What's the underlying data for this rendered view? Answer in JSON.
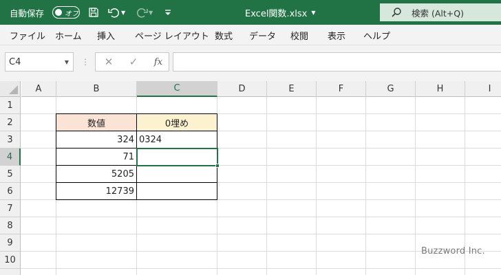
{
  "titlebar": {
    "autosave_label": "自動保存",
    "autosave_state": "オフ",
    "file_title": "Excel関数.xlsx",
    "search_text": "検索 (Alt+Q)",
    "bg_color": "#217346"
  },
  "menu": {
    "items": [
      "ファイル",
      "ホーム",
      "挿入",
      "ページ レイアウト",
      "数式",
      "データ",
      "校閲",
      "表示",
      "ヘルプ"
    ]
  },
  "formula_bar": {
    "name_box": "C4",
    "fx_label": "fx",
    "formula": ""
  },
  "sheet": {
    "columns": [
      "A",
      "B",
      "C",
      "D",
      "E",
      "F",
      "G",
      "H",
      "I"
    ],
    "rows": [
      "1",
      "2",
      "3",
      "4",
      "5",
      "6",
      "7",
      "8",
      "9",
      "10"
    ],
    "selected_column": "C",
    "selected_row": "4",
    "table": {
      "header_b": "数値",
      "header_c": "0埋め",
      "b_values": [
        "324",
        "71",
        "5205",
        "12739"
      ],
      "c_values": [
        "0324",
        "",
        "",
        ""
      ]
    }
  },
  "watermark": "Buzzword Inc.",
  "colors": {
    "excel_green": "#217346",
    "header_b_fill": "#fbe4d6",
    "header_c_fill": "#fdf2d0"
  }
}
